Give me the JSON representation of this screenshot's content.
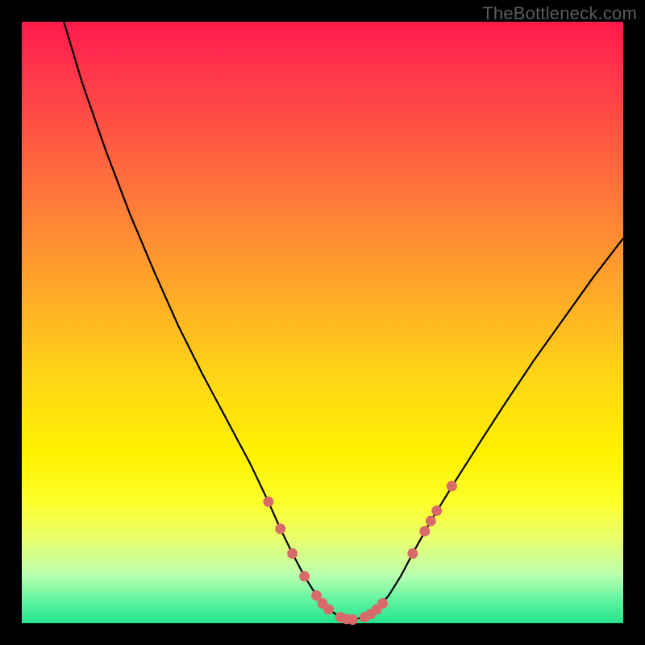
{
  "watermark": "TheBottleneck.com",
  "chart_data": {
    "type": "line",
    "title": "",
    "xlabel": "",
    "ylabel": "",
    "xlim": [
      0,
      100
    ],
    "ylim": [
      0,
      100
    ],
    "background_gradient": {
      "top": "#ff1a4d",
      "mid": "#ffd815",
      "bottom": "#23e38c"
    },
    "curve_color": "#000000",
    "marker_color": "#d86a6a",
    "curve": [
      {
        "x": 7.0,
        "y": 100.0
      },
      {
        "x": 10.0,
        "y": 90.0
      },
      {
        "x": 14.0,
        "y": 78.5
      },
      {
        "x": 18.0,
        "y": 68.0
      },
      {
        "x": 22.0,
        "y": 58.5
      },
      {
        "x": 26.0,
        "y": 49.5
      },
      {
        "x": 30.0,
        "y": 41.5
      },
      {
        "x": 34.0,
        "y": 34.0
      },
      {
        "x": 38.0,
        "y": 26.5
      },
      {
        "x": 41.0,
        "y": 20.2
      },
      {
        "x": 43.0,
        "y": 15.7
      },
      {
        "x": 45.0,
        "y": 11.6
      },
      {
        "x": 47.0,
        "y": 7.8
      },
      {
        "x": 49.0,
        "y": 4.6
      },
      {
        "x": 51.0,
        "y": 2.3
      },
      {
        "x": 53.0,
        "y": 1.0
      },
      {
        "x": 55.0,
        "y": 0.6
      },
      {
        "x": 57.0,
        "y": 1.0
      },
      {
        "x": 59.0,
        "y": 2.3
      },
      {
        "x": 61.0,
        "y": 4.6
      },
      {
        "x": 63.0,
        "y": 7.8
      },
      {
        "x": 65.0,
        "y": 11.6
      },
      {
        "x": 68.0,
        "y": 17.0
      },
      {
        "x": 72.0,
        "y": 23.5
      },
      {
        "x": 76.0,
        "y": 29.8
      },
      {
        "x": 80.0,
        "y": 36.0
      },
      {
        "x": 85.0,
        "y": 43.5
      },
      {
        "x": 90.0,
        "y": 50.5
      },
      {
        "x": 95.0,
        "y": 57.5
      },
      {
        "x": 100.0,
        "y": 64.0
      }
    ],
    "markers": [
      {
        "x": 41.0,
        "y": 20.2
      },
      {
        "x": 43.0,
        "y": 15.7
      },
      {
        "x": 45.0,
        "y": 11.6
      },
      {
        "x": 47.0,
        "y": 7.8
      },
      {
        "x": 49.0,
        "y": 4.6
      },
      {
        "x": 50.0,
        "y": 3.3
      },
      {
        "x": 51.0,
        "y": 2.3
      },
      {
        "x": 53.0,
        "y": 1.0
      },
      {
        "x": 54.0,
        "y": 0.7
      },
      {
        "x": 55.0,
        "y": 0.6
      },
      {
        "x": 57.0,
        "y": 1.0
      },
      {
        "x": 58.0,
        "y": 1.5
      },
      {
        "x": 59.0,
        "y": 2.3
      },
      {
        "x": 60.0,
        "y": 3.3
      },
      {
        "x": 65.0,
        "y": 11.6
      },
      {
        "x": 67.0,
        "y": 15.3
      },
      {
        "x": 68.0,
        "y": 17.0
      },
      {
        "x": 69.0,
        "y": 18.7
      },
      {
        "x": 71.5,
        "y": 22.8
      }
    ],
    "marker_radius_px": 6.5
  }
}
